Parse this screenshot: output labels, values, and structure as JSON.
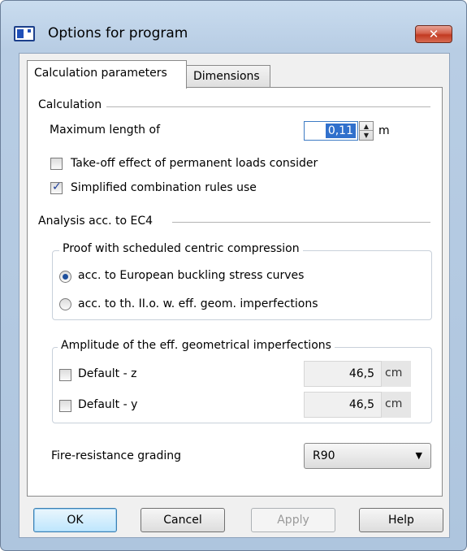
{
  "window": {
    "title": "Options for program",
    "close_symbol": "✕"
  },
  "tabs": [
    {
      "label": "Calculation parameters",
      "active": true
    },
    {
      "label": "Dimensions",
      "active": false
    }
  ],
  "calculation": {
    "group_label": "Calculation",
    "max_length_label": "Maximum length of",
    "max_length_value": "0,11",
    "max_length_unit": "m",
    "takeoff_label": "Take-off effect of permanent loads consider",
    "takeoff_checked": false,
    "simplified_label": "Simplified combination rules use",
    "simplified_checked": true
  },
  "analysis": {
    "group_label": "Analysis acc. to EC4",
    "proof_group": {
      "legend": "Proof with scheduled centric compression",
      "option1_label": "acc. to European buckling stress curves",
      "option1_selected": true,
      "option2_label": "acc. to th. II.o. w. eff. geom. imperfections",
      "option2_selected": false
    },
    "amplitude_group": {
      "legend": "Amplitude of the eff. geometrical imperfections",
      "z_label": "Default - z",
      "z_checked": false,
      "z_value": "46,5",
      "z_unit": "cm",
      "y_label": "Default - y",
      "y_checked": false,
      "y_value": "46,5",
      "y_unit": "cm"
    },
    "fire_label": "Fire-resistance grading",
    "fire_value": "R90"
  },
  "buttons": {
    "ok": "OK",
    "cancel": "Cancel",
    "apply": "Apply",
    "help": "Help"
  },
  "colors": {
    "selection": "#3070cc",
    "close_button": "#c23a21",
    "frame": "#b8cde4"
  }
}
